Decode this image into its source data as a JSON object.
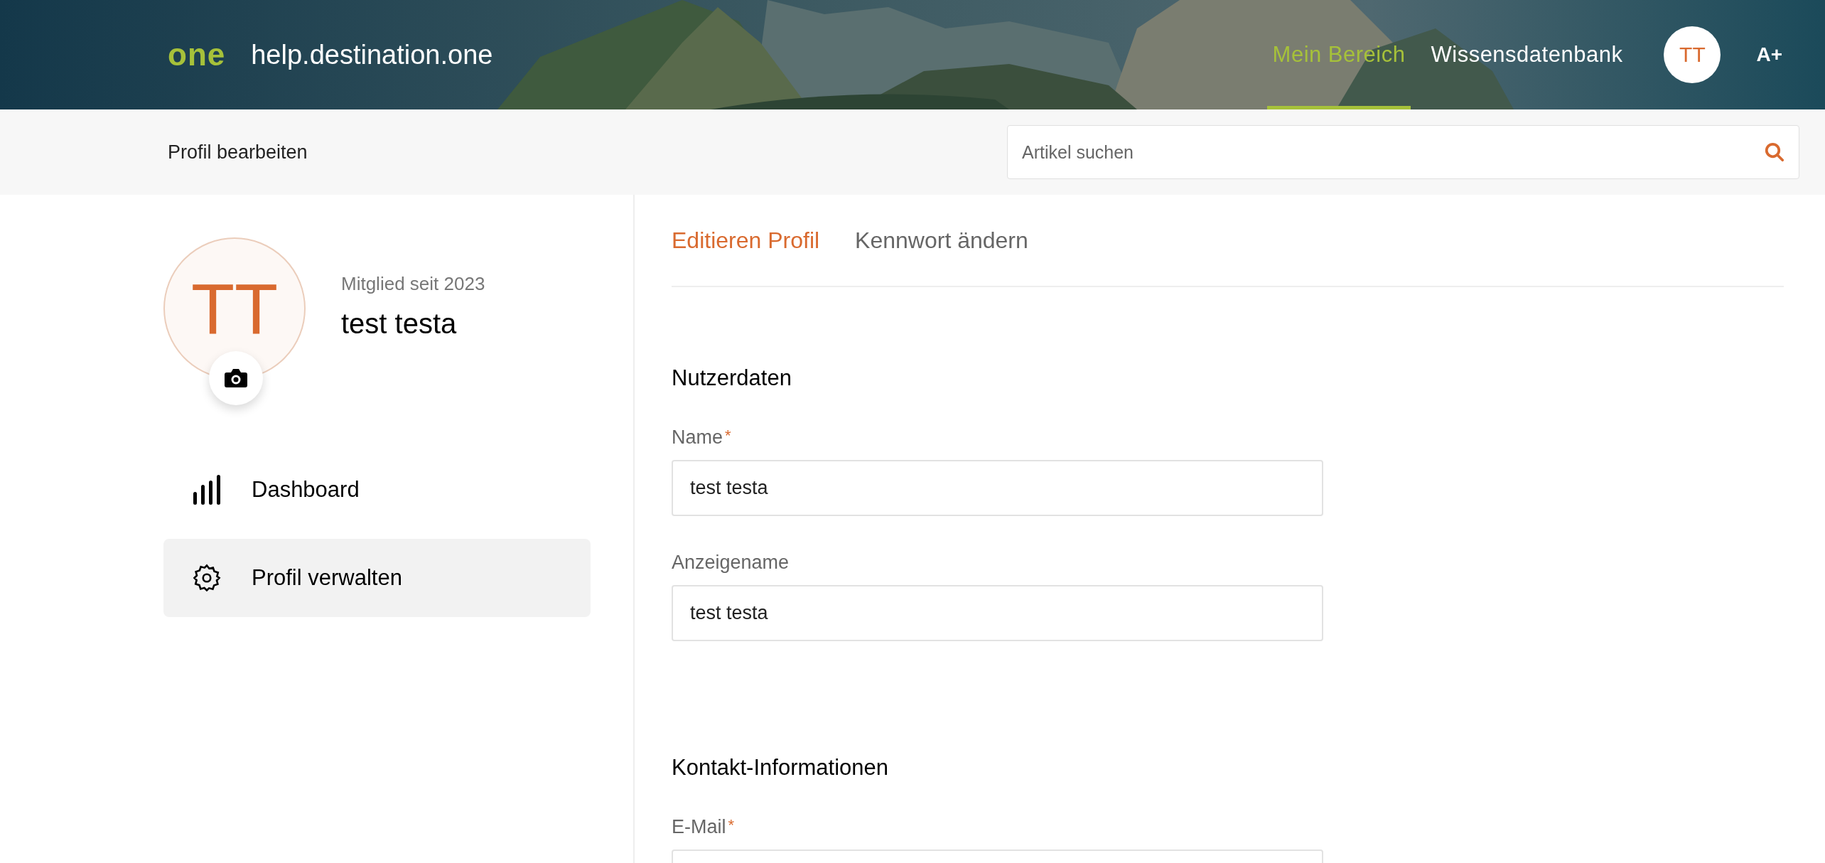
{
  "header": {
    "logo": "one",
    "site": "help.destination.one",
    "nav": [
      {
        "label": "Mein Bereich",
        "selected": true
      },
      {
        "label": "Wissensdatenbank",
        "selected": false
      }
    ],
    "avatar": "TT",
    "font_size_button": "A+"
  },
  "subheader": {
    "title": "Profil bearbeiten",
    "search": {
      "placeholder": "Artikel suchen"
    }
  },
  "profile": {
    "initials": "TT",
    "member_since": "Mitglied seit 2023",
    "name": "test testa"
  },
  "sidebar": {
    "items": [
      {
        "label": "Dashboard",
        "kind": "chart",
        "selected": false
      },
      {
        "label": "Profil verwalten",
        "kind": "settings",
        "selected": true
      }
    ]
  },
  "tabs": [
    {
      "label": "Editieren Profil",
      "selected": true
    },
    {
      "label": "Kennwort ändern",
      "selected": false
    }
  ],
  "sections": [
    {
      "title": "Nutzerdaten",
      "fields": [
        {
          "label": "Name",
          "required_mark": "*",
          "value": "test testa"
        },
        {
          "label": "Anzeigename",
          "value": "test testa"
        }
      ]
    },
    {
      "title": "Kontakt-Informationen",
      "fields": [
        {
          "label": "E-Mail",
          "required_mark": "*"
        }
      ]
    }
  ]
}
